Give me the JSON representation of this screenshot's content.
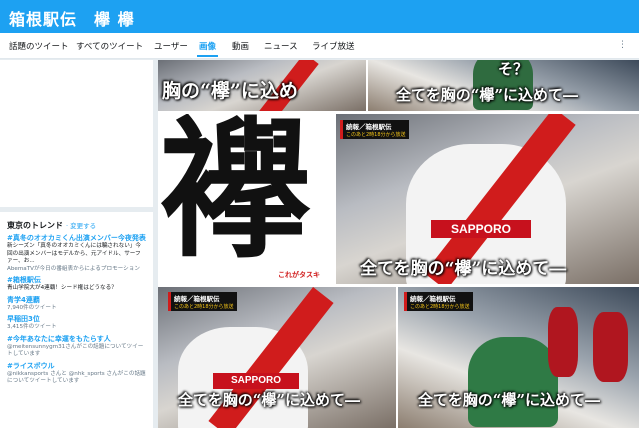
{
  "header": {
    "title": "箱根駅伝　欅 欅"
  },
  "tabs": [
    {
      "label": "話題のツイート",
      "active": false
    },
    {
      "label": "すべてのツイート",
      "active": false
    },
    {
      "label": "ユーザー",
      "active": false
    },
    {
      "label": "画像",
      "active": true
    },
    {
      "label": "動画",
      "active": false
    },
    {
      "label": "ニュース",
      "active": false
    },
    {
      "label": "ライブ放送",
      "active": false
    }
  ],
  "more_icon": "⋮",
  "trends": {
    "title": "東京のトレンド",
    "change_label": "· 変更する",
    "items": [
      {
        "tag": "#真冬のオオカミくん出演メンバー今夜発表",
        "desc": "新シーズン「真冬のオオカミくんには騙されない」今回の出演メンバーはモデルから、元アイドル、サーファー、お...",
        "source": "AbemaTVが今日の番組表からによるプロモーション"
      },
      {
        "tag": "#箱根駅伝",
        "count": "青山学院大が4連覇！シード権はどうなる？"
      },
      {
        "tag": "青学4連覇",
        "count": "7,940件のツイート"
      },
      {
        "tag": "早稲田3位",
        "count": "3,415件のツイート"
      },
      {
        "tag": "#今年あなたに幸運をもたらす人",
        "desc": "@meitensunnygm31さんがこの話題についてツイートしています"
      },
      {
        "tag": "#ライスボウル",
        "desc": "@nikkansports さんと @nhk_sports さんがこの話題についてツイートしています"
      }
    ]
  },
  "images": {
    "top_left_caption": "胸の“欅”に込め",
    "top_right_caption": "全てを胸の“欅”に込めて―",
    "top_right_question": "そ？",
    "kanji": "襷",
    "kanji_sub": "これがタスキ",
    "big_badge_title": "続報／箱根駅伝",
    "big_badge_sub": "このあと2時18分から放送",
    "sponsor": "SAPPORO",
    "big_caption": "全てを胸の“欅”に込めて―",
    "bl_badge_title": "続報／箱根駅伝",
    "bl_badge_sub": "このあと2時18分から放送",
    "bl_caption": "全てを胸の“欅”に込めて―",
    "br_badge_title": "続報／箱根駅伝",
    "br_badge_sub": "このあと2時18分から放送",
    "br_caption": "全てを胸の“欅”に込めて―"
  },
  "colors": {
    "brand": "#1da1f2",
    "sash": "#d01c1c"
  }
}
